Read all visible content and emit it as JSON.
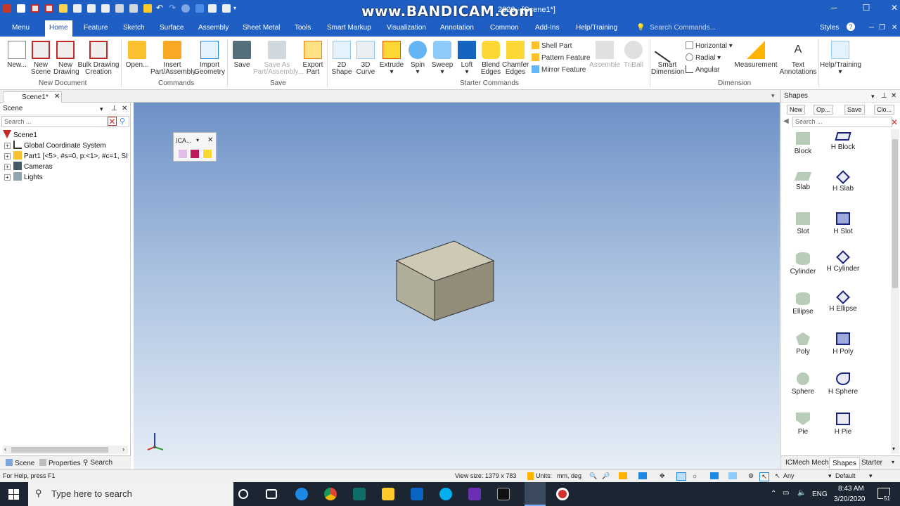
{
  "app": {
    "title": "2020 - [Scene1*]",
    "watermark": "www.BANDICAM.com"
  },
  "ribbon_tabs": [
    "Menu",
    "Home",
    "Feature",
    "Sketch",
    "Surface",
    "Assembly",
    "Sheet Metal",
    "Tools",
    "Smart Markup",
    "Visualization",
    "Annotation",
    "Common",
    "Add-Ins",
    "Help/Training"
  ],
  "search_commands": "Search Commands...",
  "styles_label": "Styles",
  "ribbon": {
    "new": "New...",
    "new_scene": [
      "New",
      "Scene"
    ],
    "new_drawing": [
      "New",
      "Drawing"
    ],
    "bulk_drawing": [
      "Bulk Drawing",
      "Creation"
    ],
    "group_new_document": "New Document",
    "open": "Open...",
    "insert_part": [
      "Insert",
      "Part/Assembly"
    ],
    "import_geometry": [
      "Import",
      "Geometry"
    ],
    "group_commands": "Commands",
    "save": "Save",
    "save_as": [
      "Save As",
      "Part/Assembly..."
    ],
    "export_part": [
      "Export",
      "Part"
    ],
    "group_save": "Save",
    "shape_2d": [
      "2D",
      "Shape"
    ],
    "curve_3d": [
      "3D",
      "Curve"
    ],
    "extrude": "Extrude",
    "spin": "Spin",
    "sweep": "Sweep",
    "loft": "Loft",
    "blend_edges": [
      "Blend",
      "Edges"
    ],
    "chamfer_edges": [
      "Chamfer",
      "Edges"
    ],
    "shell_part": "Shell Part",
    "pattern_feature": "Pattern Feature",
    "mirror_feature": "Mirror Feature",
    "assemble": "Assemble",
    "triball": "TriBall",
    "group_starter": "Starter Commands",
    "smart_dimension": [
      "Smart",
      "Dimension"
    ],
    "horizontal": "Horizontal",
    "radial": "Radial",
    "angular": "Angular",
    "measurement": "Measurement",
    "text_annotations": [
      "Text",
      "Annotations"
    ],
    "group_dimension": "Dimension",
    "help_training": "Help/Training"
  },
  "doc_tab": "Scene1*",
  "scene_panel": {
    "title": "Scene",
    "search_placeholder": "Search ...",
    "tree": [
      {
        "label": "Scene1"
      },
      {
        "label": "Global Coordinate System"
      },
      {
        "label": "Part1 [<5>, #s=0, p:<1>, #c=1, SI"
      },
      {
        "label": "Cameras"
      },
      {
        "label": "Lights"
      }
    ],
    "footer_tabs": [
      "Scene",
      "Properties",
      "Search"
    ]
  },
  "ica_toolbar": {
    "title": "ICA..."
  },
  "shapes_panel": {
    "title": "Shapes",
    "buttons": [
      "New",
      "Op...",
      "Save",
      "Clo..."
    ],
    "search_placeholder": "Search ...",
    "items": [
      [
        "Block",
        "H Block"
      ],
      [
        "Slab",
        "H Slab"
      ],
      [
        "Slot",
        "H Slot"
      ],
      [
        "Cylinder",
        "H Cylinder"
      ],
      [
        "Ellipse",
        "H Ellipse"
      ],
      [
        "Poly",
        "H Poly"
      ],
      [
        "Sphere",
        "H Sphere"
      ],
      [
        "Pie",
        "H Pie"
      ]
    ],
    "footer_tabs": [
      "ICMech Mech",
      "Shapes",
      "Starter"
    ]
  },
  "status": {
    "help": "For Help, press F1",
    "view_size": "View size: 1379 x 783",
    "units_label": "Units:",
    "units_value": "mm, deg",
    "filter": "Any",
    "style": "Default"
  },
  "taskbar": {
    "search": "Type here to search",
    "time": "8:43 AM",
    "date": "3/20/2020",
    "lang": "ENG",
    "notifications": "51"
  },
  "colors": {
    "title_blue": "#1f5fc4",
    "viewport_top": "#6d91c6",
    "viewport_bottom": "#e6eef7",
    "box_top": "#cdc9b4",
    "box_front": "#b0ad98",
    "box_side": "#918d78"
  }
}
